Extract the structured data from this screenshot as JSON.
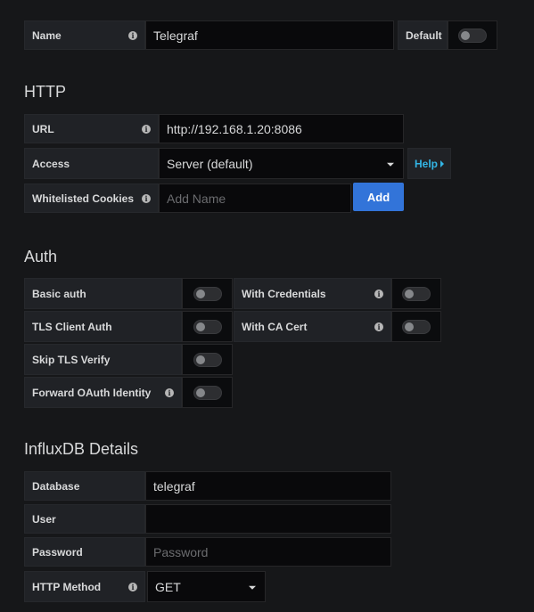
{
  "general": {
    "name_label": "Name",
    "name_value": "Telegraf",
    "default_label": "Default"
  },
  "http": {
    "heading": "HTTP",
    "url_label": "URL",
    "url_value": "http://192.168.1.20:8086",
    "access_label": "Access",
    "access_value": "Server (default)",
    "help_label": "Help",
    "cookies_label": "Whitelisted Cookies",
    "cookies_placeholder": "Add Name",
    "add_label": "Add"
  },
  "auth": {
    "heading": "Auth",
    "basic_auth": "Basic auth",
    "with_credentials": "With Credentials",
    "tls_client_auth": "TLS Client Auth",
    "with_ca_cert": "With CA Cert",
    "skip_tls_verify": "Skip TLS Verify",
    "forward_oauth": "Forward OAuth Identity"
  },
  "influx": {
    "heading": "InfluxDB Details",
    "database_label": "Database",
    "database_value": "telegraf",
    "user_label": "User",
    "user_value": "",
    "password_label": "Password",
    "password_placeholder": "Password",
    "method_label": "HTTP Method",
    "method_value": "GET"
  },
  "icons": {
    "info": "info-icon",
    "caret": "caret-down-icon",
    "help_arrow": "caret-right-icon"
  },
  "colors": {
    "background": "#161719",
    "input_bg": "#09090b",
    "label_bg": "#202226",
    "accent": "#3274d9",
    "link": "#33b5e5"
  }
}
